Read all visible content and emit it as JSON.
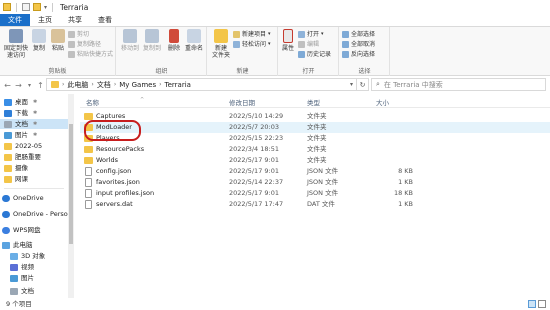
{
  "window": {
    "title": "Terraria"
  },
  "ribbon_tabs": [
    "文件",
    "主页",
    "共享",
    "查看"
  ],
  "ribbon": {
    "clipboard": {
      "group_label": "剪贴板",
      "pin_label": "固定到快\n速访问",
      "copy_label": "复制",
      "paste_label": "粘贴",
      "cut_label": "剪切",
      "copy_path_label": "复制路径",
      "paste_shortcut_label": "粘贴快捷方式"
    },
    "organize": {
      "group_label": "组织",
      "move_to_label": "移动到",
      "copy_to_label": "复制到",
      "delete_label": "删除",
      "rename_label": "重命名"
    },
    "new": {
      "group_label": "新建",
      "new_folder_label": "新建\n文件夹",
      "new_item_label": "新建项目",
      "easy_access_label": "轻松访问"
    },
    "open": {
      "group_label": "打开",
      "properties_label": "属性",
      "open_label": "打开",
      "edit_label": "编辑",
      "history_label": "历史记录"
    },
    "select": {
      "group_label": "选择",
      "select_all_label": "全部选择",
      "select_none_label": "全部取消",
      "invert_label": "反向选择"
    }
  },
  "address": {
    "crumbs": [
      "此电脑",
      "文档",
      "My Games",
      "Terraria"
    ],
    "search_placeholder": "在 Terraria 中搜索"
  },
  "nav": {
    "items": [
      {
        "label": "桌面",
        "pinned": true,
        "color": "#3a8ee6"
      },
      {
        "label": "下载",
        "pinned": true,
        "color": "#2f7fd8"
      },
      {
        "label": "文档",
        "pinned": true,
        "color": "#9aa7b5",
        "selected": true
      },
      {
        "label": "图片",
        "pinned": true,
        "color": "#4a9ad6"
      },
      {
        "label": "2022-05",
        "pinned": false,
        "color": "#f3c548"
      },
      {
        "label": "肥肠重要",
        "pinned": false,
        "color": "#f3c548"
      },
      {
        "label": "摄像",
        "pinned": false,
        "color": "#f3c548"
      },
      {
        "label": "网课",
        "pinned": false,
        "color": "#f3c548"
      },
      {
        "label": "OneDrive",
        "pinned": false,
        "color": "#2b78d4"
      },
      {
        "label": "OneDrive - Perso",
        "pinned": false,
        "color": "#2b78d4"
      },
      {
        "label": "WPS网盘",
        "pinned": false,
        "color": "#3b7fe0"
      },
      {
        "label": "此电脑",
        "pinned": false,
        "color": "#5ba3e0"
      },
      {
        "label": "3D 对象",
        "pinned": false,
        "color": "#6aaee6"
      },
      {
        "label": "视频",
        "pinned": false,
        "color": "#5b6fd6"
      },
      {
        "label": "图片",
        "pinned": false,
        "color": "#4a9ad6"
      },
      {
        "label": "文档",
        "pinned": false,
        "color": "#9aa7b5"
      }
    ]
  },
  "columns": {
    "name": "名称",
    "date": "修改日期",
    "type": "类型",
    "size": "大小"
  },
  "files": [
    {
      "name": "Captures",
      "date": "2022/5/10 14:29",
      "type": "文件夹",
      "size": "",
      "kind": "folder"
    },
    {
      "name": "ModLoader",
      "date": "2022/5/7 20:03",
      "type": "文件夹",
      "size": "",
      "kind": "folder",
      "selected": true
    },
    {
      "name": "Players",
      "date": "2022/5/15 22:23",
      "type": "文件夹",
      "size": "",
      "kind": "folder"
    },
    {
      "name": "ResourcePacks",
      "date": "2022/3/4 18:51",
      "type": "文件夹",
      "size": "",
      "kind": "folder"
    },
    {
      "name": "Worlds",
      "date": "2022/5/17 9:01",
      "type": "文件夹",
      "size": "",
      "kind": "folder"
    },
    {
      "name": "config.json",
      "date": "2022/5/17 9:01",
      "type": "JSON 文件",
      "size": "8 KB",
      "kind": "file"
    },
    {
      "name": "favorites.json",
      "date": "2022/5/14 22:37",
      "type": "JSON 文件",
      "size": "1 KB",
      "kind": "file"
    },
    {
      "name": "input profiles.json",
      "date": "2022/5/17 9:01",
      "type": "JSON 文件",
      "size": "18 KB",
      "kind": "file"
    },
    {
      "name": "servers.dat",
      "date": "2022/5/17 17:47",
      "type": "DAT 文件",
      "size": "1 KB",
      "kind": "file"
    }
  ],
  "status": {
    "count": "9 个项目"
  }
}
